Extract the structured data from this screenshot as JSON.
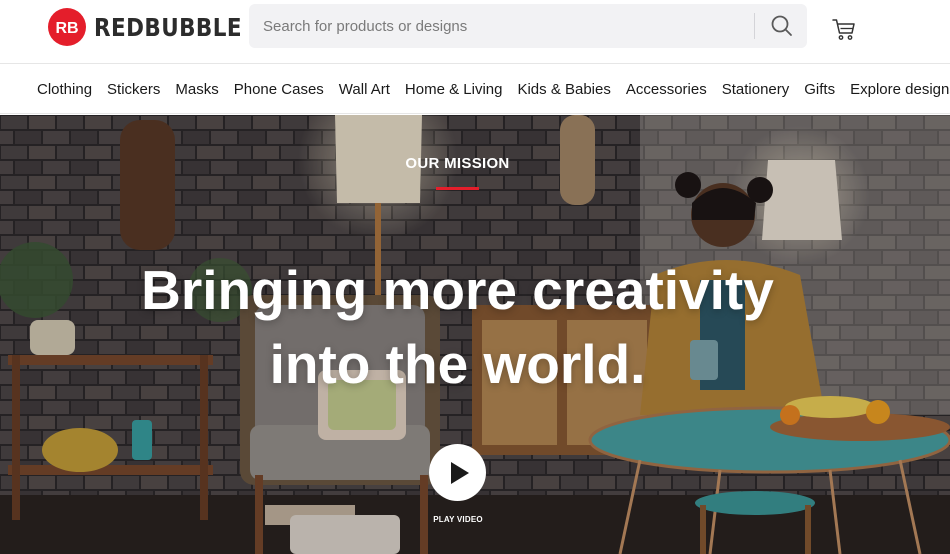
{
  "brand": {
    "name": "REDBUBBLE",
    "mark": "RB",
    "color": "#e41e2b"
  },
  "search": {
    "placeholder": "Search for products or designs",
    "button_icon": "search-icon"
  },
  "cart": {
    "icon": "cart-icon"
  },
  "nav": {
    "items": [
      "Clothing",
      "Stickers",
      "Masks",
      "Phone Cases",
      "Wall Art",
      "Home & Living",
      "Kids & Babies",
      "Accessories",
      "Stationery",
      "Gifts",
      "Explore designs"
    ]
  },
  "hero": {
    "eyebrow": "OUR MISSION",
    "headline_line1": "Bringing more creativity",
    "headline_line2": "into the world.",
    "play_label": "PLAY VIDEO",
    "play_icon": "play-icon",
    "accent_color": "#e41e2b"
  }
}
